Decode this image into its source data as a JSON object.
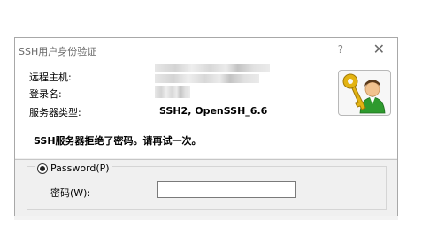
{
  "dialog": {
    "title": "SSH用户身份验证",
    "help_glyph": "?",
    "close_glyph": "✕"
  },
  "info": {
    "remote_host_label": "远程主机:",
    "login_name_label": "登录名:",
    "server_type_label": "服务器类型:",
    "server_type_value": "SSH2, OpenSSH_6.6",
    "icon": "user-key-icon"
  },
  "message": "SSH服务器拒绝了密码。请再试一次。",
  "auth": {
    "method_label": "Password(P)",
    "method_selected": true,
    "password_label": "密码(W):",
    "password_value": ""
  },
  "colors": {
    "dialog_bg": "#f0f0f0",
    "panel_bg": "#ffffff",
    "key_gold": "#e3b312",
    "shirt_green": "#2e9a2e"
  }
}
